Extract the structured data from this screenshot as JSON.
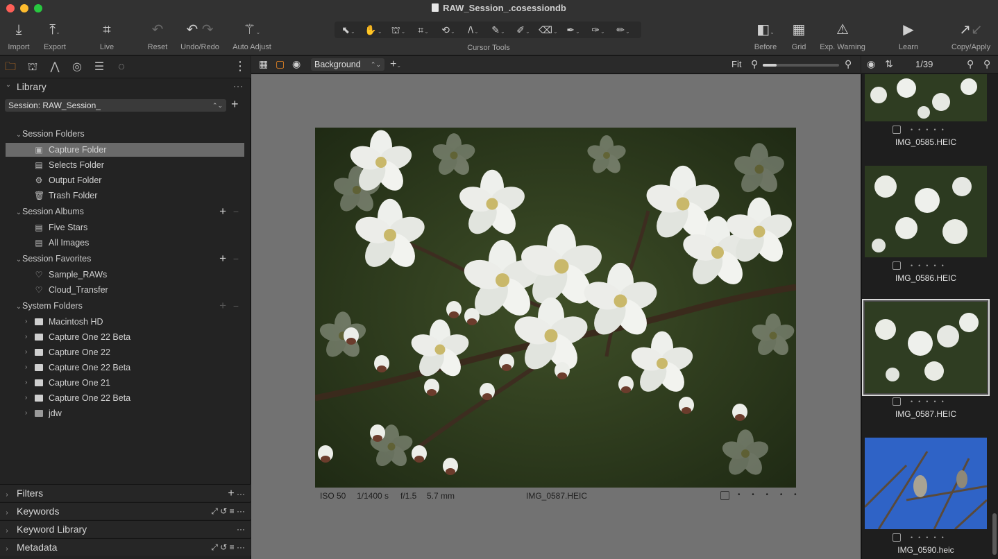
{
  "window": {
    "title": "RAW_Session_.cosessiondb",
    "traffic": [
      "#fe5f57",
      "#febc2e",
      "#28c840"
    ]
  },
  "toolbar": {
    "import": "Import",
    "export": "Export",
    "live": "Live",
    "reset": "Reset",
    "undo_redo": "Undo/Redo",
    "auto_adjust": "Auto Adjust",
    "cursor_tools": "Cursor Tools",
    "before": "Before",
    "grid": "Grid",
    "exp_warning": "Exp. Warning",
    "learn": "Learn",
    "copy_apply": "Copy/Apply"
  },
  "left": {
    "library_title": "Library",
    "session_select": "Session: RAW_Session_",
    "groups": {
      "session_folders": "Session Folders",
      "session_albums": "Session Albums",
      "session_favorites": "Session Favorites",
      "system_folders": "System Folders"
    },
    "session_folders": [
      "Capture Folder",
      "Selects Folder",
      "Output Folder",
      "Trash Folder"
    ],
    "session_albums": [
      "Five Stars",
      "All Images"
    ],
    "session_favorites": [
      "Sample_RAWs",
      "Cloud_Transfer"
    ],
    "system_folders": [
      "Macintosh HD",
      "Capture One 22 Beta",
      "Capture One 22",
      "Capture One 22 Beta",
      "Capture One 21",
      "Capture One 22 Beta",
      "jdw"
    ],
    "bottom_sections": [
      "Filters",
      "Keywords",
      "Keyword Library",
      "Metadata"
    ]
  },
  "viewer": {
    "background_select": "Background",
    "fit_label": "Fit",
    "zoom_fraction": 0.18,
    "info": {
      "iso": "ISO 50",
      "shutter": "1/1400 s",
      "aperture": "f/1.5",
      "focal": "5.7 mm",
      "filename": "IMG_0587.HEIC"
    }
  },
  "browser": {
    "count": "1/39",
    "thumbs": [
      {
        "name": "IMG_0585.HEIC",
        "selected": false
      },
      {
        "name": "IMG_0586.HEIC",
        "selected": false
      },
      {
        "name": "IMG_0587.HEIC",
        "selected": true
      },
      {
        "name": "IMG_0590.heic",
        "selected": false
      }
    ]
  },
  "accent_color": "#f08a24"
}
